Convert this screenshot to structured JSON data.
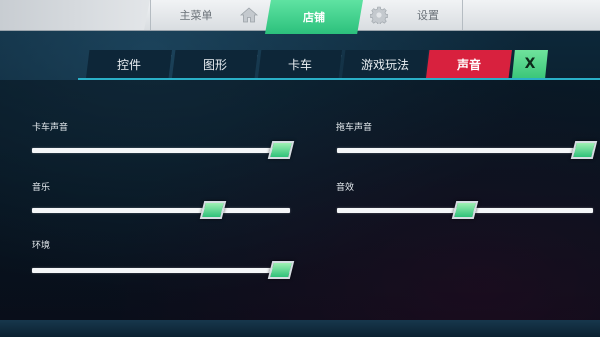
{
  "top_nav": {
    "main_menu": "主菜单",
    "store": "店铺",
    "settings": "设置",
    "home_icon": "home-icon",
    "gear_icon": "gear-icon"
  },
  "tabs": {
    "controls": "控件",
    "graphics": "图形",
    "truck": "卡车",
    "gameplay": "游戏玩法",
    "sound": "声音",
    "close": "X",
    "active": "sound"
  },
  "sliders": [
    {
      "id": "truck-sound",
      "label": "卡车声音",
      "value": 1.0
    },
    {
      "id": "trailer-sound",
      "label": "拖车声音",
      "value": 1.0
    },
    {
      "id": "music",
      "label": "音乐",
      "value": 0.7
    },
    {
      "id": "effects",
      "label": "音效",
      "value": 0.5
    },
    {
      "id": "ambient",
      "label": "环境",
      "value": 1.0
    }
  ],
  "colors": {
    "active_tab": "#d8213e",
    "accent_green": "#2cc07c",
    "tab_bg": "#0d2638",
    "track": "#f4f6f8"
  }
}
